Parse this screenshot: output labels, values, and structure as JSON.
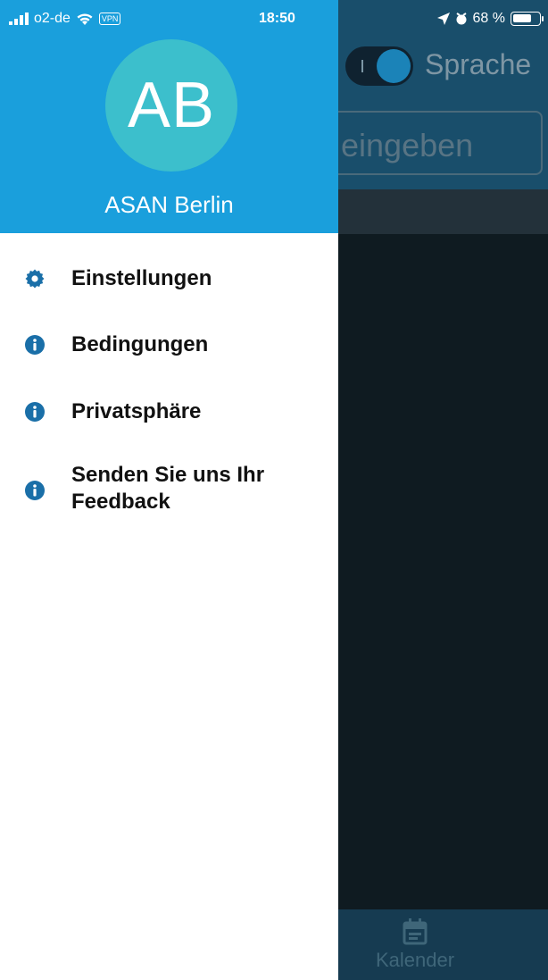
{
  "status_bar": {
    "carrier": "o2-de",
    "vpn": "VPN",
    "time": "18:50",
    "battery": "68 %"
  },
  "background": {
    "language_label": "Sprache",
    "search_placeholder": "eingeben",
    "tab_label": "Kalender"
  },
  "drawer": {
    "avatar_initials": "AB",
    "profile_name": "ASAN Berlin",
    "menu": [
      {
        "label": "Einstellungen",
        "icon": "gear-icon"
      },
      {
        "label": "Bedingungen",
        "icon": "info-icon"
      },
      {
        "label": "Privatsphäre",
        "icon": "info-icon"
      },
      {
        "label": "Senden Sie uns Ihr Feedback",
        "icon": "info-icon"
      }
    ]
  },
  "colors": {
    "drawer_header": "#1a9fdc",
    "avatar": "#3cbfcc",
    "icon": "#1a6fa8",
    "backdrop": "#0f1b21"
  }
}
